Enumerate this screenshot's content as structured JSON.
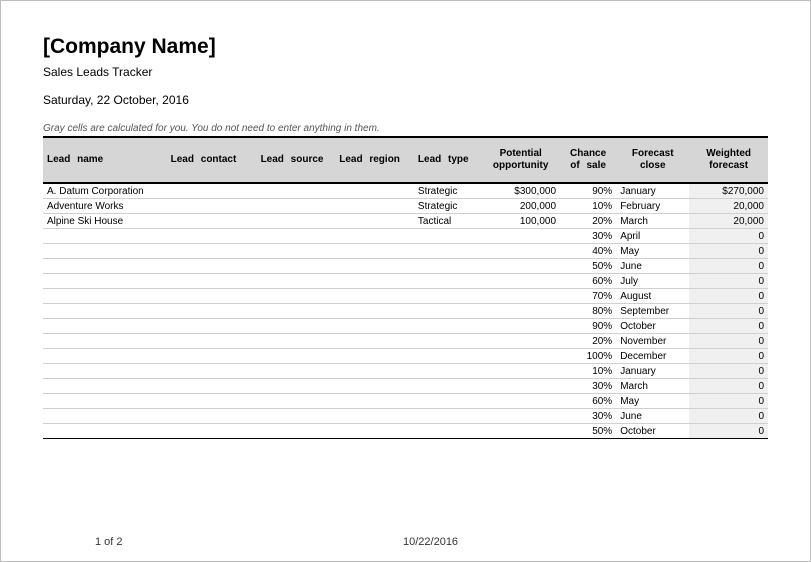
{
  "header": {
    "company_name": "[Company Name]",
    "subtitle": "Sales Leads Tracker",
    "date_text": "Saturday, 22 October, 2016",
    "calc_note": "Gray cells are calculated for you. You do not need to enter anything in them."
  },
  "columns": {
    "name": "Lead name",
    "contact": "Lead contact",
    "source": "Lead source",
    "region": "Lead region",
    "type": "Lead type",
    "opportunity": "Potential opportunity",
    "chance": "Chance of sale",
    "forecast_close": "Forecast close",
    "weighted": "Weighted forecast"
  },
  "rows": [
    {
      "name": "A. Datum Corporation",
      "contact": "",
      "source": "",
      "region": "",
      "type": "Strategic",
      "opportunity": "$300,000",
      "chance": "90%",
      "forecast_close": "January",
      "weighted": "$270,000"
    },
    {
      "name": "Adventure Works",
      "contact": "",
      "source": "",
      "region": "",
      "type": "Strategic",
      "opportunity": "200,000",
      "chance": "10%",
      "forecast_close": "February",
      "weighted": "20,000"
    },
    {
      "name": "Alpine Ski House",
      "contact": "",
      "source": "",
      "region": "",
      "type": "Tactical",
      "opportunity": "100,000",
      "chance": "20%",
      "forecast_close": "March",
      "weighted": "20,000"
    },
    {
      "name": "",
      "contact": "",
      "source": "",
      "region": "",
      "type": "",
      "opportunity": "",
      "chance": "30%",
      "forecast_close": "April",
      "weighted": "0"
    },
    {
      "name": "",
      "contact": "",
      "source": "",
      "region": "",
      "type": "",
      "opportunity": "",
      "chance": "40%",
      "forecast_close": "May",
      "weighted": "0"
    },
    {
      "name": "",
      "contact": "",
      "source": "",
      "region": "",
      "type": "",
      "opportunity": "",
      "chance": "50%",
      "forecast_close": "June",
      "weighted": "0"
    },
    {
      "name": "",
      "contact": "",
      "source": "",
      "region": "",
      "type": "",
      "opportunity": "",
      "chance": "60%",
      "forecast_close": "July",
      "weighted": "0"
    },
    {
      "name": "",
      "contact": "",
      "source": "",
      "region": "",
      "type": "",
      "opportunity": "",
      "chance": "70%",
      "forecast_close": "August",
      "weighted": "0"
    },
    {
      "name": "",
      "contact": "",
      "source": "",
      "region": "",
      "type": "",
      "opportunity": "",
      "chance": "80%",
      "forecast_close": "September",
      "weighted": "0"
    },
    {
      "name": "",
      "contact": "",
      "source": "",
      "region": "",
      "type": "",
      "opportunity": "",
      "chance": "90%",
      "forecast_close": "October",
      "weighted": "0"
    },
    {
      "name": "",
      "contact": "",
      "source": "",
      "region": "",
      "type": "",
      "opportunity": "",
      "chance": "20%",
      "forecast_close": "November",
      "weighted": "0"
    },
    {
      "name": "",
      "contact": "",
      "source": "",
      "region": "",
      "type": "",
      "opportunity": "",
      "chance": "100%",
      "forecast_close": "December",
      "weighted": "0"
    },
    {
      "name": "",
      "contact": "",
      "source": "",
      "region": "",
      "type": "",
      "opportunity": "",
      "chance": "10%",
      "forecast_close": "January",
      "weighted": "0"
    },
    {
      "name": "",
      "contact": "",
      "source": "",
      "region": "",
      "type": "",
      "opportunity": "",
      "chance": "30%",
      "forecast_close": "March",
      "weighted": "0"
    },
    {
      "name": "",
      "contact": "",
      "source": "",
      "region": "",
      "type": "",
      "opportunity": "",
      "chance": "60%",
      "forecast_close": "May",
      "weighted": "0"
    },
    {
      "name": "",
      "contact": "",
      "source": "",
      "region": "",
      "type": "",
      "opportunity": "",
      "chance": "30%",
      "forecast_close": "June",
      "weighted": "0"
    },
    {
      "name": "",
      "contact": "",
      "source": "",
      "region": "",
      "type": "",
      "opportunity": "",
      "chance": "50%",
      "forecast_close": "October",
      "weighted": "0"
    }
  ],
  "footer": {
    "page_number": "1 of 2",
    "footer_date": "10/22/2016"
  }
}
